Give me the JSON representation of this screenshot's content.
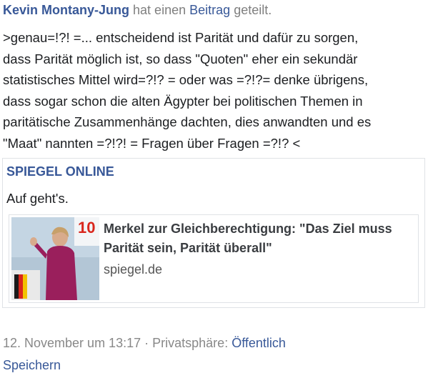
{
  "post": {
    "author": "Kevin Montany-Jung",
    "action_prefix": "hat einen",
    "action_link": "Beitrag",
    "action_suffix": "geteilt.",
    "lines": [
      ">genau=!?! =... entscheidend ist Parität und dafür zu sorgen,",
      "dass Parität möglich ist, so dass \"Quoten\" eher ein sekundär",
      "statistisches Mittel wird=?!? = oder was =?!?= denke übrigens,",
      "dass sogar schon die alten Ägypter bei politischen Themen in",
      "paritätische Zusammenhänge dachten, dies anwandten und es",
      "\"Maat\" nannten =?!?! = Fragen über Fragen =?!? <"
    ]
  },
  "shared": {
    "page_name": "SPIEGEL ONLINE",
    "text": "Auf geht's.",
    "link": {
      "title": "Merkel zur Gleichberechtigung: \"Das Ziel muss Parität sein, Parität überall\"",
      "domain": "spiegel.de",
      "thumb_number": "10"
    }
  },
  "footer": {
    "date": "12. November um 13:17",
    "separator": "·",
    "privacy_label": "Privatsphäre:",
    "privacy_value": "Öffentlich",
    "cut_text": "Speichern"
  },
  "colors": {
    "link": "#385898",
    "muted": "#7f7f7f",
    "border": "#dfe2e6"
  }
}
